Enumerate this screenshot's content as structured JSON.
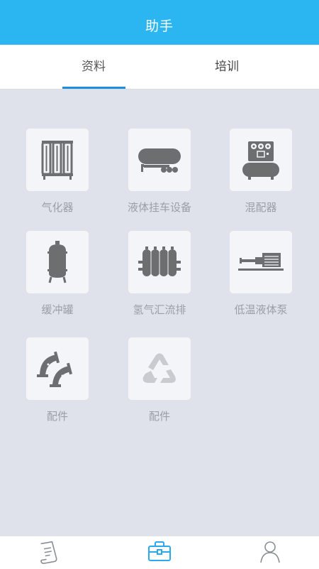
{
  "header": {
    "title": "助手"
  },
  "tabs": [
    {
      "label": "资料",
      "active": true
    },
    {
      "label": "培训",
      "active": false
    }
  ],
  "items": [
    {
      "label": "气化器",
      "icon": "vaporizer-icon"
    },
    {
      "label": "液体挂车设备",
      "icon": "tank-trailer-icon"
    },
    {
      "label": "混配器",
      "icon": "mixer-icon"
    },
    {
      "label": "缓冲罐",
      "icon": "buffer-tank-icon"
    },
    {
      "label": "氢气汇流排",
      "icon": "hydrogen-manifold-icon"
    },
    {
      "label": "低温液体泵",
      "icon": "cryogenic-pump-icon"
    },
    {
      "label": "配件",
      "icon": "fittings-icon"
    },
    {
      "label": "配件",
      "icon": "recycle-icon"
    }
  ],
  "bottom_nav": [
    {
      "icon": "document-icon"
    },
    {
      "icon": "briefcase-icon",
      "active": true
    },
    {
      "icon": "user-icon"
    }
  ],
  "colors": {
    "header_bg": "#2bb6f2",
    "tab_indicator": "#1c8fdc",
    "content_bg": "#dfe2ea",
    "tile_bg": "#f4f5f8",
    "icon_gray": "#6d6e70",
    "active_nav": "#2aa9ee"
  }
}
